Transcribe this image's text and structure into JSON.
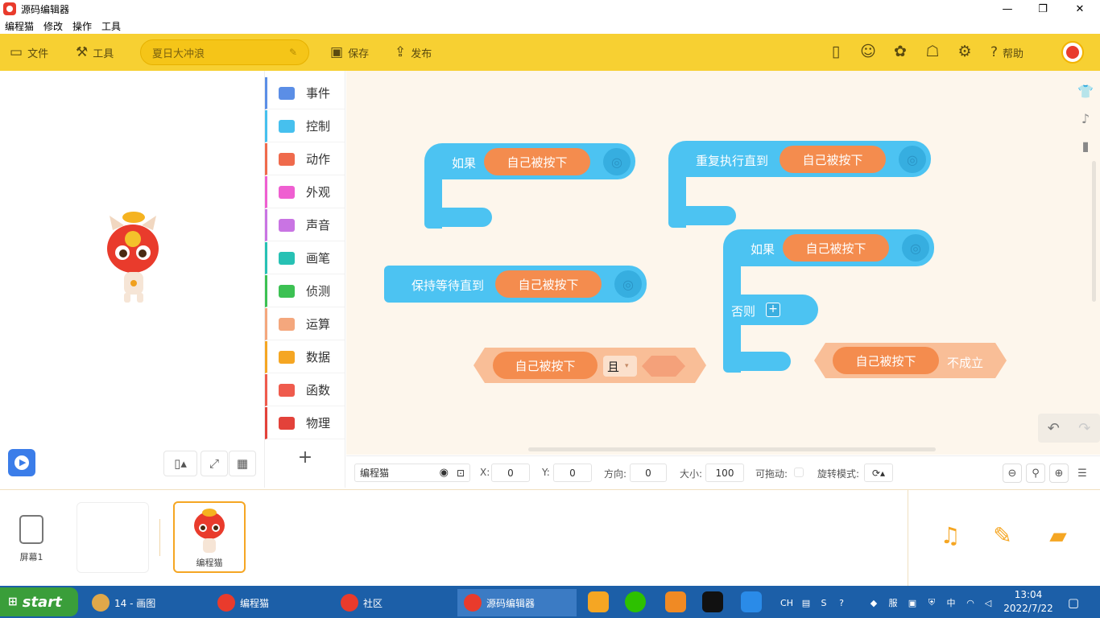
{
  "window": {
    "title": "源码编辑器",
    "minimize": "—",
    "restore": "❐",
    "close": "✕"
  },
  "menu": [
    "编程猫",
    "修改",
    "操作",
    "工具"
  ],
  "toolbar": {
    "file": "文件",
    "tools": "工具",
    "project_name": "夏日大冲浪",
    "save": "保存",
    "publish": "发布",
    "help": "帮助"
  },
  "categories": [
    {
      "label": "事件",
      "color": "#5b8ee6"
    },
    {
      "label": "控制",
      "color": "#46c0ee"
    },
    {
      "label": "动作",
      "color": "#ef6a4c"
    },
    {
      "label": "外观",
      "color": "#ef5fd1"
    },
    {
      "label": "声音",
      "color": "#c974e3"
    },
    {
      "label": "画笔",
      "color": "#27c1b4"
    },
    {
      "label": "侦测",
      "color": "#3cc153"
    },
    {
      "label": "运算",
      "color": "#f4a77d"
    },
    {
      "label": "数据",
      "color": "#f5a623"
    },
    {
      "label": "函数",
      "color": "#ef5b4d"
    },
    {
      "label": "物理",
      "color": "#e3423a"
    }
  ],
  "add_category": "+",
  "blocks": {
    "if1": {
      "label": "如果",
      "cond": "自己被按下"
    },
    "repeat_until": {
      "label": "重复执行直到",
      "cond": "自己被按下"
    },
    "wait_until": {
      "label": "保持等待直到",
      "cond": "自己被按下"
    },
    "if_else": {
      "label": "如果",
      "cond": "自己被按下",
      "else_label": "否则",
      "else_add": "+"
    },
    "and_op": {
      "cond": "自己被按下",
      "op": "且",
      "op_arrow": "▾"
    },
    "not_op": {
      "cond": "自己被按下",
      "suffix": "不成立"
    }
  },
  "properties": {
    "sprite_name": "编程猫",
    "x_label": "X:",
    "x": "0",
    "y_label": "Y:",
    "y": "0",
    "dir_label": "方向:",
    "dir": "0",
    "size_label": "大小:",
    "size": "100",
    "drag_label": "可拖动:",
    "rotate_label": "旋转模式:"
  },
  "bottom": {
    "screen_label": "屏幕1",
    "sprite_label": "编程猫"
  },
  "taskbar": {
    "start": "start",
    "tasks": [
      "14 - 画图",
      "编程猫",
      "社区",
      "源码编辑器"
    ],
    "tray_lang": "CH",
    "ime": "中",
    "tray_extra": "服",
    "time": "13:04",
    "date": "2022/7/22"
  }
}
